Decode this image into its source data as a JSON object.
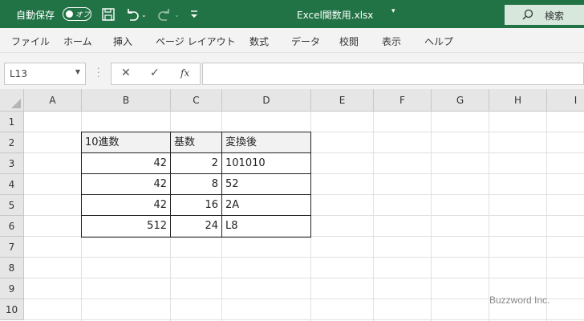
{
  "titlebar": {
    "autosave_label": "自動保存",
    "autosave_state": "オフ",
    "file_title": "Excel関数用.xlsx",
    "title_caret": "▾",
    "search_label": "検索",
    "icons": [
      "save-icon",
      "undo-icon",
      "redo-icon",
      "customize-quick-access-icon",
      "search-icon"
    ],
    "colors": {
      "brand": "#217346"
    }
  },
  "menu": {
    "items": [
      "ファイル",
      "ホーム",
      "挿入",
      "ページ レイアウト",
      "数式",
      "データ",
      "校閲",
      "表示",
      "ヘルプ"
    ]
  },
  "formula_bar": {
    "name_box": "L13",
    "cancel_glyph": "✕",
    "enter_glyph": "✓",
    "fx_label": "fx",
    "formula": ""
  },
  "sheet": {
    "columns": [
      "A",
      "B",
      "C",
      "D",
      "E",
      "F",
      "G",
      "H",
      "I"
    ],
    "rows": [
      "1",
      "2",
      "3",
      "4",
      "5",
      "6",
      "7",
      "8",
      "9",
      "10"
    ],
    "table": {
      "headers": [
        "10進数",
        "基数",
        "変換後"
      ],
      "rows": [
        {
          "decimal": "42",
          "base": "2",
          "converted": "101010"
        },
        {
          "decimal": "42",
          "base": "8",
          "converted": "52"
        },
        {
          "decimal": "42",
          "base": "16",
          "converted": "2A"
        },
        {
          "decimal": "512",
          "base": "24",
          "converted": "L8"
        }
      ]
    }
  },
  "watermark": "Buzzword Inc."
}
